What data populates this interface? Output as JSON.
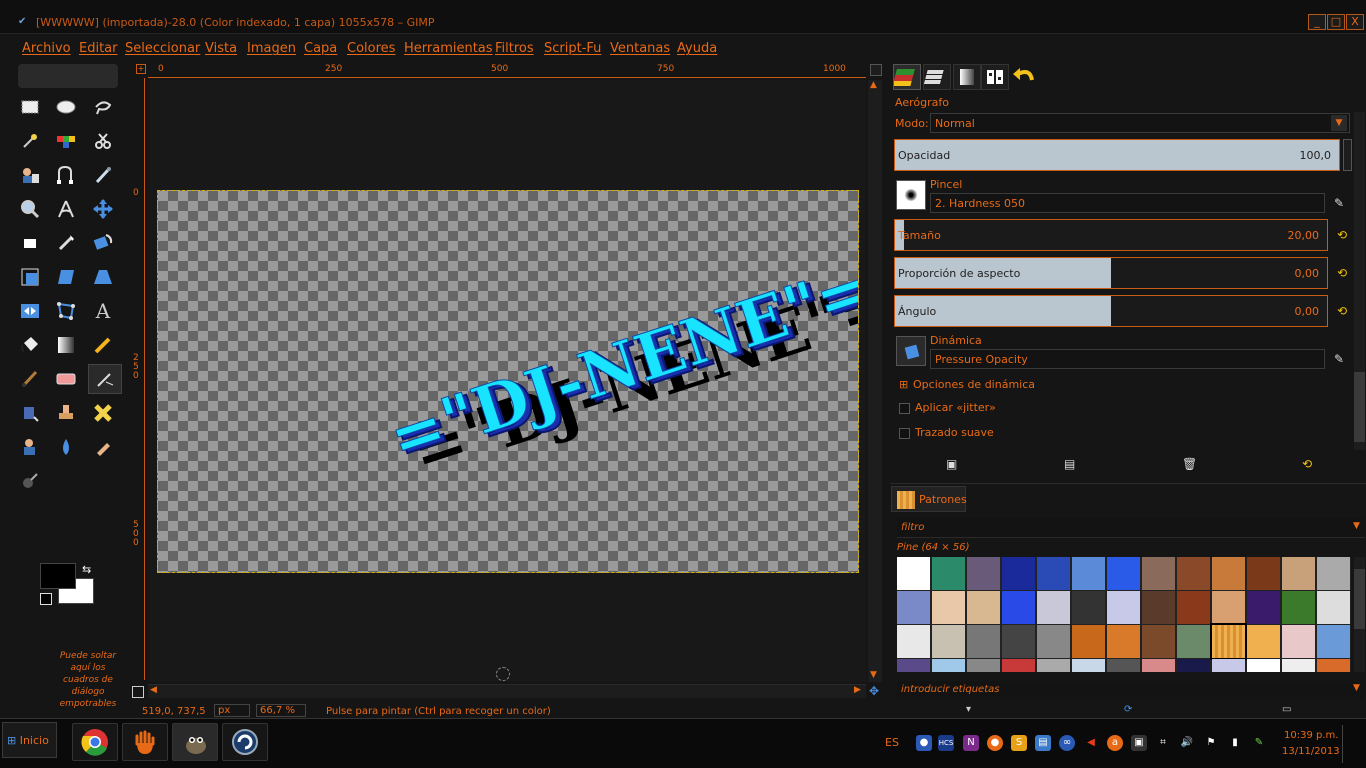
{
  "window": {
    "title": "[WWWWW] (importada)-28.0 (Color indexado, 1 capa) 1055x578 – GIMP",
    "minimize": "_",
    "maximize": "□",
    "close": "X"
  },
  "menu": [
    "Archivo",
    "Editar",
    "Seleccionar",
    "Vista",
    "Imagen",
    "Capa",
    "Colores",
    "Herramientas",
    "Filtros",
    "Script-Fu",
    "Ventanas",
    "Ayuda"
  ],
  "ruler": {
    "h_ticks": [
      "0",
      "250",
      "500",
      "750",
      "1000"
    ],
    "v_ticks": [
      "0",
      "2\n5\n0",
      "5\n0\n0"
    ]
  },
  "canvas": {
    "image_text": "=\"DJ-NENE\"="
  },
  "toolbox": {
    "dock_hint": "Puede soltar aquí los cuadros de diálogo empotrables"
  },
  "status": {
    "coords": "519,0, 737,5",
    "unit": "px",
    "zoom": "66,7 %",
    "message": "Pulse para pintar (Ctrl para recoger un color)"
  },
  "tool_options": {
    "tool_name": "Aerógrafo",
    "mode_label": "Modo:",
    "mode_value": "Normal",
    "opacity_label": "Opacidad",
    "opacity_value": "100,0",
    "opacity_fraction": 1.0,
    "brush_label": "Pincel",
    "brush_value": "2. Hardness 050",
    "size_label": "Tamaño",
    "size_value": "20,00",
    "size_fraction": 0.02,
    "aspect_label": "Proporción de aspecto",
    "aspect_value": "0,00",
    "aspect_fraction": 0.5,
    "angle_label": "Ángulo",
    "angle_value": "0,00",
    "angle_fraction": 0.5,
    "dynamics_label": "Dinámica",
    "dynamics_value": "Pressure Opacity",
    "dynamics_options": "Opciones de dinámica",
    "jitter_label": "Aplicar «jitter»",
    "smooth_label": "Trazado suave"
  },
  "patterns": {
    "tab_label": "Patrones",
    "filter_placeholder": "filtro",
    "selected_name": "Pine (64 × 56)",
    "tags_placeholder": "introducir etiquetas"
  },
  "taskbar": {
    "start": "Inicio",
    "lang": "ES",
    "time": "10:39 p.m.",
    "date": "13/11/2013"
  },
  "colors": {
    "accent": "#e86a17",
    "bg": "#151515",
    "fg_color": "#000000",
    "bg_color": "#ffffff"
  }
}
